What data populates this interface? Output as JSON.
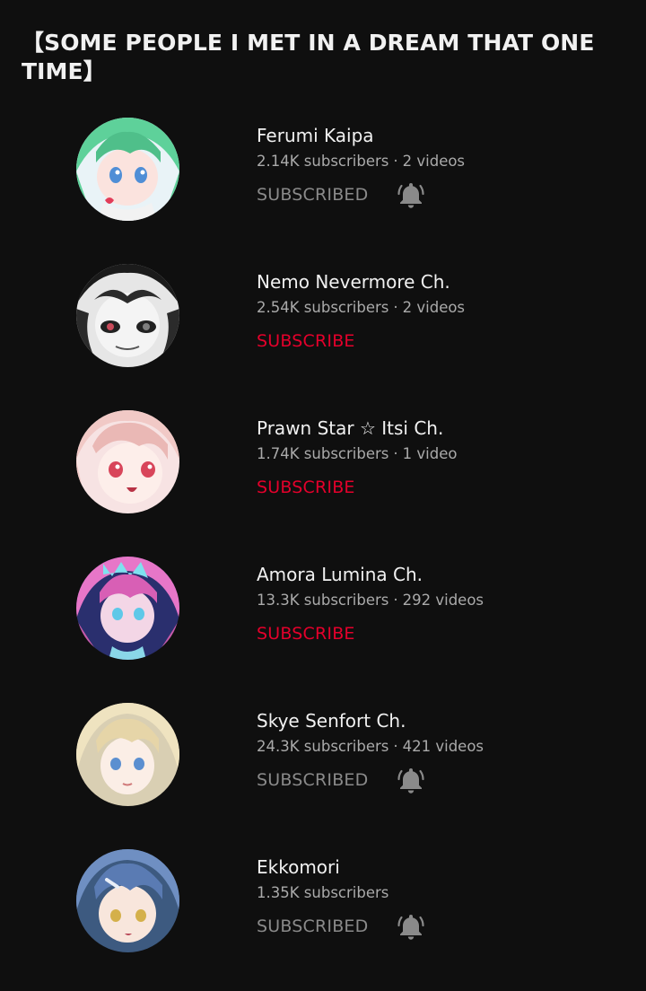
{
  "section": {
    "title": "【SOME PEOPLE I MET IN A DREAM THAT ONE TIME】"
  },
  "channels": [
    {
      "name": "Ferumi Kaipa",
      "subscribers": "2.14K subscribers",
      "separator": "·",
      "videos": "2 videos",
      "button_label": "SUBSCRIBED",
      "subscribed": true,
      "bell_icon": "notification-bell-icon",
      "avatar_colors": {
        "bg": "#e9f3f7",
        "hair": "#5ed19a",
        "skin": "#fbe3de",
        "eye": "#4f8ed6"
      }
    },
    {
      "name": "Nemo Nevermore Ch.",
      "subscribers": "2.54K subscribers",
      "separator": "·",
      "videos": "2 videos",
      "button_label": "SUBSCRIBE",
      "subscribed": false,
      "avatar_colors": {
        "bg": "#e6e6e6",
        "hair": "#1b1b1b",
        "skin": "#f4f4f4",
        "eye": "#c94b5b"
      }
    },
    {
      "name": "Prawn Star ☆ Itsi Ch.",
      "subscribers": "1.74K subscribers",
      "separator": "·",
      "videos": "1 video",
      "button_label": "SUBSCRIBE",
      "subscribed": false,
      "avatar_colors": {
        "bg": "#f7e3e3",
        "hair": "#f1c9c6",
        "skin": "#fdeeea",
        "eye": "#d8455a"
      }
    },
    {
      "name": "Amora Lumina Ch.",
      "subscribers": "13.3K subscribers",
      "separator": "·",
      "videos": "292 videos",
      "button_label": "SUBSCRIBE",
      "subscribed": false,
      "avatar_colors": {
        "bg": "#2a2f6e",
        "hair": "#e776c8",
        "skin": "#f3d6e6",
        "eye": "#5ec8e8"
      }
    },
    {
      "name": "Skye Senfort Ch.",
      "subscribers": "24.3K subscribers",
      "separator": "·",
      "videos": "421 videos",
      "button_label": "SUBSCRIBED",
      "subscribed": true,
      "bell_icon": "notification-bell-icon",
      "avatar_colors": {
        "bg": "#d9cfb3",
        "hair": "#efe3c0",
        "skin": "#fbeee6",
        "eye": "#5b8fd0"
      }
    },
    {
      "name": "Ekkomori",
      "subscribers": "1.35K subscribers",
      "separator": "",
      "videos": "",
      "button_label": "SUBSCRIBED",
      "subscribed": true,
      "bell_icon": "notification-bell-icon",
      "avatar_colors": {
        "bg": "#3d5a80",
        "hair": "#6f8fc2",
        "skin": "#f8e6dc",
        "eye": "#d4b04a"
      }
    }
  ],
  "colors": {
    "background": "#0f0f0f",
    "text_primary": "#f1f1f1",
    "text_secondary": "#aaaaaa",
    "subscribe_red": "#e4002b",
    "subscribed_gray": "#8a8a8a"
  }
}
